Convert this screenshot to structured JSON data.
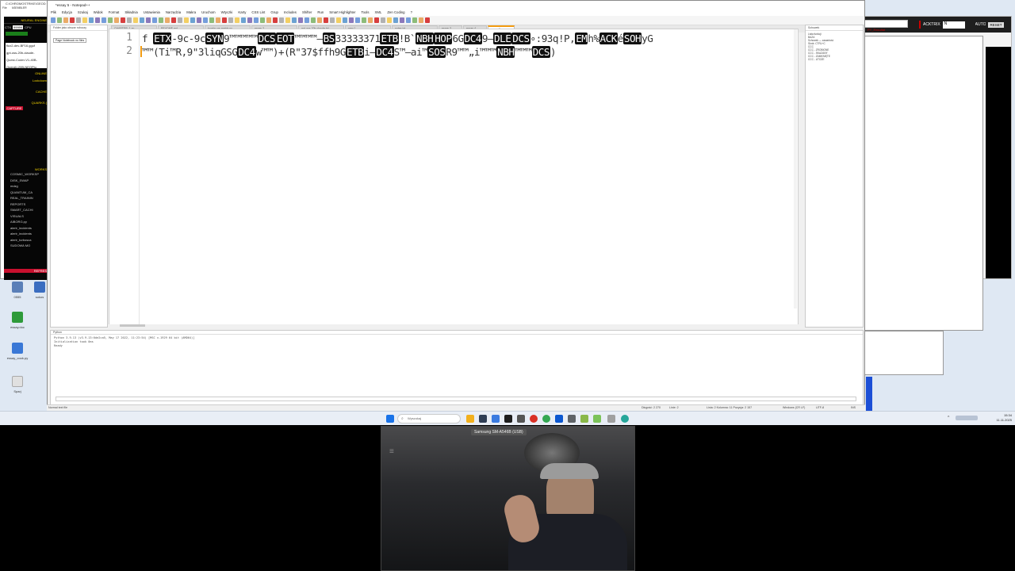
{
  "desktop": {
    "icons": [
      {
        "label": "0555"
      },
      {
        "label": "sokos"
      },
      {
        "label": "essay.doc"
      },
      {
        "label": "essay_cook.py"
      },
      {
        "label": "Sparj"
      }
    ]
  },
  "left_app": {
    "title": "C:\\CHROMOSTRIKE\\GEOD",
    "menu_left": "File",
    "menu_right": "ASEMBLER",
    "engine_header": "NEURAL ENGINE",
    "ctx_label": "CTX",
    "ctx_value": "99999",
    "cpu_label": "CPU",
    "models": [
      "flux2-dev-BF16.gguf",
      "gpt-oss-20b-claude-",
      "Quest-Coder-V1-40B-",
      "OpenAI-20B-NEOPlu"
    ],
    "online": "ONLINE",
    "lockdown": "Lockdown",
    "cache": "CACHE",
    "quarks": "QUARKS (",
    "capture": "CAPTURE",
    "workspace_header": "WORKS",
    "files": [
      "COSMIC_WORKSP",
      "DISK_SWAP",
      "mdzg",
      "QUANTUM_CA",
      "REAL_TRAININ",
      "REPORTS",
      "SMART_CACHI",
      "VISUALS",
      "AIBORG.py",
      "alerir_incidents",
      "alerir_incidents",
      "alerir_turbosca",
      "SUDOWA MO"
    ],
    "refresh": "REFRES"
  },
  "editor": {
    "window_title": "*essay 5 - Notepad++",
    "menu": [
      "Plik",
      "Edycja",
      "Szukaj",
      "Widok",
      "Format",
      "Składnia",
      "Ustawienia",
      "Narzędzia",
      "Makra",
      "Uruchom",
      "Wtyczki",
      "Karty",
      "CSS Lint",
      "Grup",
      "Includes",
      "Shifter",
      "Run",
      "Smart Highlighter",
      "Tools",
      "XML",
      "Zen Coding",
      "?"
    ],
    "tabs": [
      {
        "label": "CHAPTER_1.py",
        "active": false
      },
      {
        "label": "README.md",
        "active": false
      },
      {
        "label": "tovaho-ne-matrix.py",
        "active": false
      },
      {
        "label": "essay 2",
        "active": false
      },
      {
        "label": "gpt-oss-20b-claude.txt",
        "active": false
      },
      {
        "label": "new 1",
        "active": false
      },
      {
        "label": "notes.txt",
        "active": false
      },
      {
        "label": "essay 3",
        "active": false
      },
      {
        "label": "essay 4",
        "active": false
      },
      {
        "label": "essay 5",
        "active": true
      }
    ],
    "folder_pane_title": "Folder jako obszar roboczy",
    "folder_pane_hint": "Page Notebook no files",
    "line_numbers": [
      "1",
      "2"
    ],
    "line1": [
      {
        "t": "f ",
        "c": false
      },
      {
        "t": "ETX",
        "c": true
      },
      {
        "t": "-9c-9c",
        "c": false
      },
      {
        "t": "SYN",
        "c": true
      },
      {
        "t": "⁡9™™™™™",
        "c": false
      },
      {
        "t": "DCS",
        "c": true
      },
      {
        "t": "EOT",
        "c": true
      },
      {
        "t": "™™™™—",
        "c": false
      },
      {
        "t": "BS",
        "c": true
      },
      {
        "t": "33333371",
        "c": false
      },
      {
        "t": "ETB",
        "c": true
      },
      {
        "t": "!B`",
        "c": false
      },
      {
        "t": "NBH",
        "c": true
      },
      {
        "t": "HOP",
        "c": true
      },
      {
        "t": "6G",
        "c": false
      },
      {
        "t": "DC4",
        "c": true
      },
      {
        "t": "9—",
        "c": false
      },
      {
        "t": "DLE",
        "c": true
      },
      {
        "t": "DCS",
        "c": true
      },
      {
        "t": "∘:93q!P,",
        "c": false
      },
      {
        "t": "EM",
        "c": true
      },
      {
        "t": "h%",
        "c": false
      },
      {
        "t": "ACK",
        "c": true
      },
      {
        "t": "é",
        "c": false
      },
      {
        "t": "SOH",
        "c": true
      },
      {
        "t": "yG",
        "c": false
      }
    ],
    "line2": [
      {
        "t": "™™(Ti™R,9\"3liqGSG",
        "c": false
      },
      {
        "t": "DC4",
        "c": true
      },
      {
        "t": "w™™)+(R\"37$ffh9G",
        "c": false
      },
      {
        "t": "ETB",
        "c": true
      },
      {
        "t": "i—",
        "c": false
      },
      {
        "t": "DC4",
        "c": true
      },
      {
        "t": "S™—ai™",
        "c": false
      },
      {
        "t": "SOS",
        "c": true
      },
      {
        "t": "R9™™„i™™™",
        "c": false
      },
      {
        "t": "NBH",
        "c": true
      },
      {
        "t": "™™™",
        "c": false
      },
      {
        "t": "DCS",
        "c": true
      },
      {
        "t": ")",
        "c": false
      }
    ],
    "right_pane_title": "Schowek",
    "right_pane_items": [
      "Lista funkcji",
      "BAZA",
      "Schowek — zawartość",
      "Skrót: CTRL+C",
      "CCC",
      "CCC - ZROBIONE",
      "CCC - SKAZANY",
      "CCC - ZAMKNIĘTE",
      "CCC - UTOŻE"
    ],
    "console_title": "Python",
    "console_lines": [
      "Python 3.9.13 (v3.9.13:6de2ca5, May 17 2022, 11:23:54) [MSC v.1929 64 bit (AMD64)]",
      "Initialization took 0ms",
      "Ready"
    ],
    "status": {
      "type": "Normal text file",
      "length": "Długość: 2 270",
      "lines": "Linie: 2",
      "position": "Linia: 2    Kolumna: 11    Pozycja: 2 157",
      "eol": "Windows (CR LF)",
      "encoding": "UTF-8",
      "mode": "INS"
    }
  },
  "right_app": {
    "acktrix": "ACKTRIX",
    "input_value": "N",
    "auto": "AUTO",
    "reset": "RESET",
    "tab_label": "PY_Rezultat"
  },
  "taskbar": {
    "search_placeholder": "Wyszukaj",
    "time": "15:34",
    "date": "11.11.2025"
  },
  "webcam": {
    "label": "Samsung SM-A546B (USB)"
  }
}
